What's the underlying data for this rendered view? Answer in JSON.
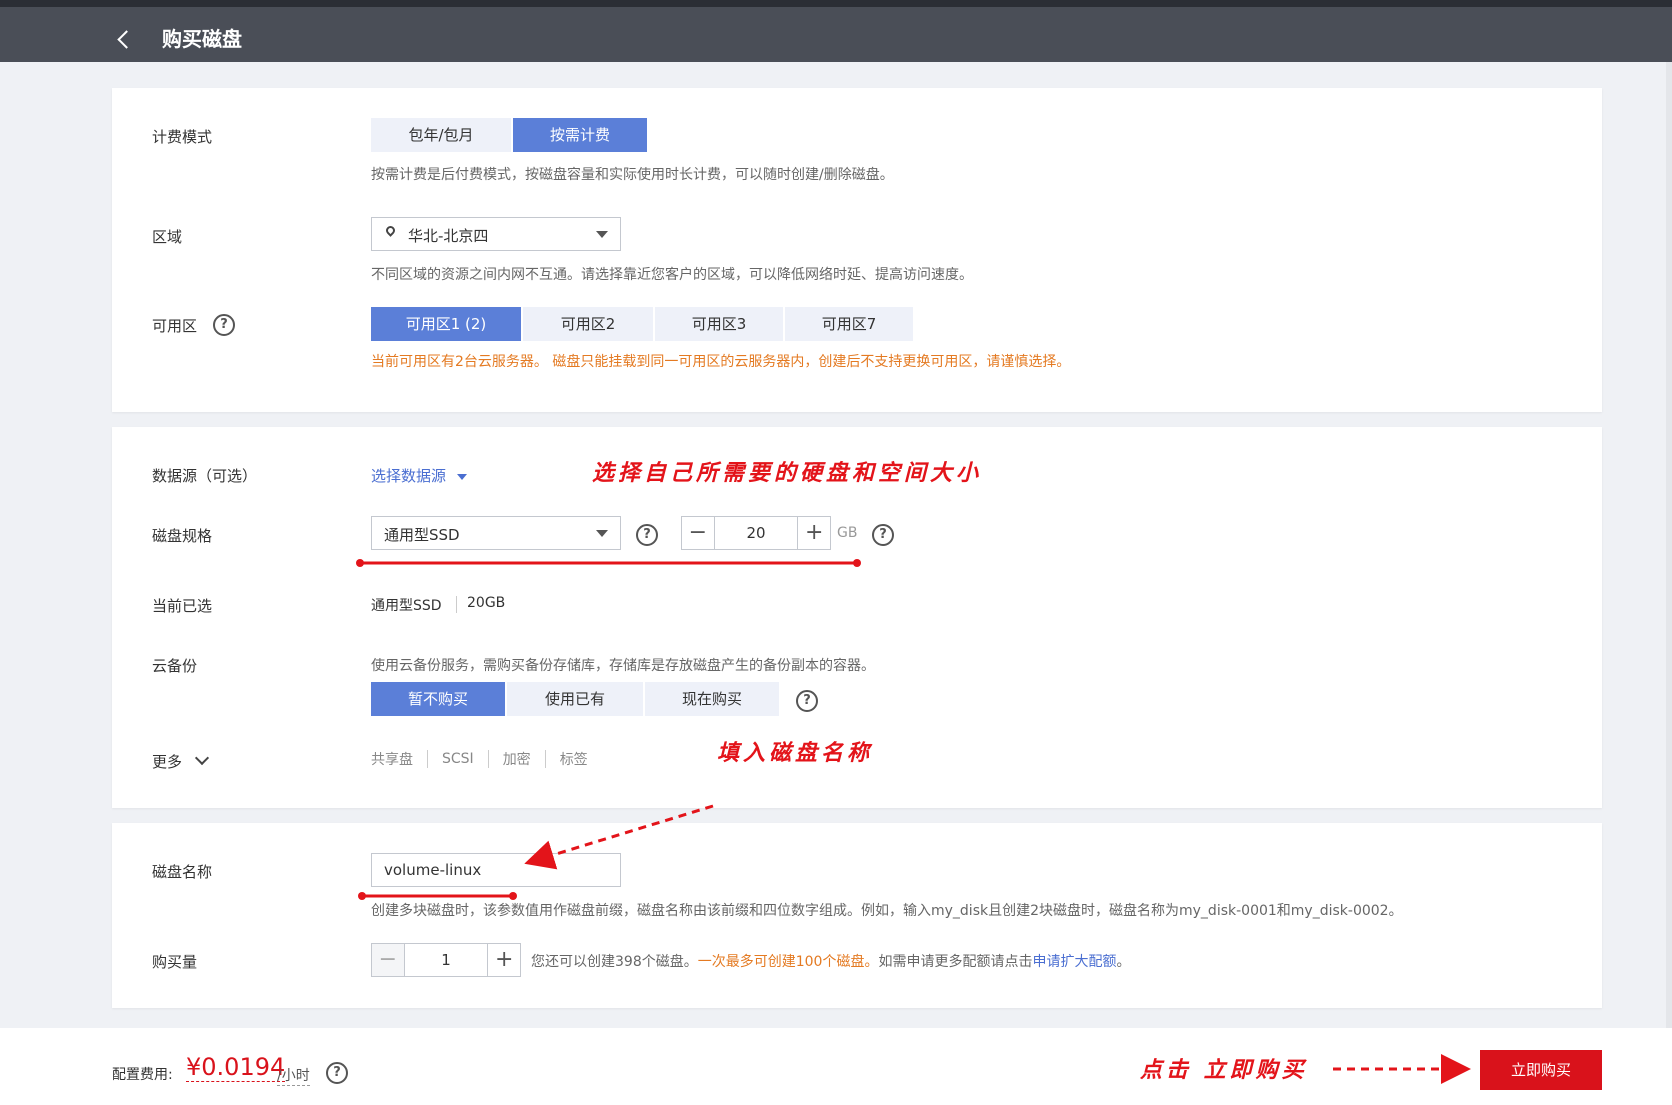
{
  "header": {
    "title": "购买磁盘"
  },
  "billing": {
    "label": "计费模式",
    "options": [
      "包年/包月",
      "按需计费"
    ],
    "selected": "按需计费",
    "hint": "按需计费是后付费模式，按磁盘容量和实际使用时长计费，可以随时创建/删除磁盘。"
  },
  "region": {
    "label": "区域",
    "value": "华北-北京四",
    "hint": "不同区域的资源之间内网不互通。请选择靠近您客户的区域，可以降低网络时延、提高访问速度。"
  },
  "az": {
    "label": "可用区",
    "options": [
      "可用区1 (2)",
      "可用区2",
      "可用区3",
      "可用区7"
    ],
    "selected": "可用区1 (2)",
    "hint": "当前可用区有2台云服务器。 磁盘只能挂载到同一可用区的云服务器内，创建后不支持更换可用区，请谨慎选择。"
  },
  "datasource": {
    "label": "数据源（可选）",
    "link": "选择数据源"
  },
  "spec": {
    "label": "磁盘规格",
    "type": "通用型SSD",
    "size": "20",
    "unit": "GB"
  },
  "current": {
    "label": "当前已选",
    "type": "通用型SSD",
    "size": "20GB"
  },
  "backup": {
    "label": "云备份",
    "hint": "使用云备份服务，需购买备份存储库，存储库是存放磁盘产生的备份副本的容器。",
    "options": [
      "暂不购买",
      "使用已有",
      "现在购买"
    ],
    "selected": "暂不购买"
  },
  "more": {
    "label": "更多",
    "tags": [
      "共享盘",
      "SCSI",
      "加密",
      "标签"
    ]
  },
  "name": {
    "label": "磁盘名称",
    "value": "volume-linux",
    "hint": "创建多块磁盘时，该参数值用作磁盘前缀，磁盘名称由该前缀和四位数字组成。例如，输入my_disk且创建2块磁盘时，磁盘名称为my_disk-0001和my_disk-0002。"
  },
  "quantity": {
    "label": "购买量",
    "value": "1",
    "hint_a": "您还可以创建398个磁盘。",
    "hint_b": "一次最多可创建100个磁盘。",
    "hint_c": "如需申请更多配额请点击",
    "hint_link": "申请扩大配额",
    "hint_end": "。"
  },
  "footer": {
    "fee_label": "配置费用:",
    "price": "¥0.0194",
    "unit": "/小时",
    "buy_label": "立即购买"
  },
  "annotations": {
    "a1": "选择自己所需要的硬盘和空间大小",
    "a2": "填入磁盘名称",
    "a3": "点击 立即购买"
  },
  "colors": {
    "accent": "#5b7fd8",
    "header_bg": "#4a4e57",
    "warn": "#e47a22",
    "buy": "#d9121b",
    "annotation": "#e3141a"
  }
}
